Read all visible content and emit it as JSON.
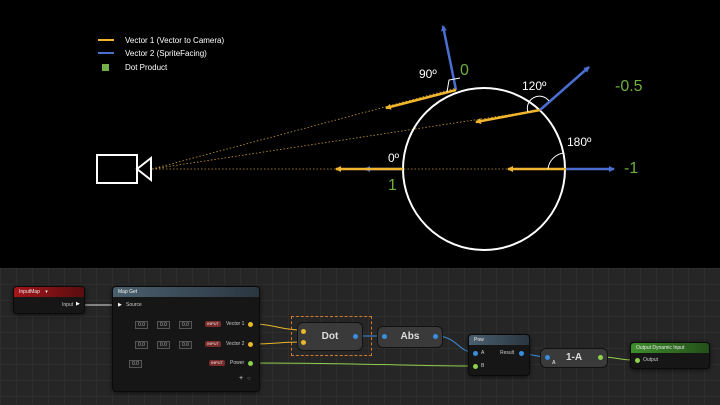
{
  "legend": {
    "vector1": "Vector 1 (Vector to Camera)",
    "vector2": "Vector 2 (SpriteFacing)",
    "dot": "Dot Product"
  },
  "angles": {
    "a90": "90º",
    "a120": "120º",
    "a180": "180º",
    "a0": "0º"
  },
  "values": {
    "v0": "0",
    "v_half": "-0.5",
    "v_neg1": "-1",
    "v1": "1"
  },
  "colors": {
    "vector1": "#f2b62e",
    "vector2": "#4a6fd0",
    "dot": "#74b04a",
    "value_text": "#6fae3e"
  },
  "nodes": {
    "input_map": {
      "title": "InputMap",
      "pin": "Input"
    },
    "map_get": {
      "title": "Map Get",
      "source": "Source",
      "vec1_tag": "INPUT",
      "vec1": "Vector 1",
      "vec2_tag": "INPUT",
      "vec2": "Vector 2",
      "power_tag": "INPUT",
      "power": "Power",
      "vec1_values": [
        "0.0",
        "0.0",
        "0.0"
      ],
      "vec2_values": [
        "0.0",
        "0.0",
        "0.0"
      ],
      "power_value": "0.0"
    },
    "dot": {
      "title": "Dot"
    },
    "abs": {
      "title": "Abs"
    },
    "pow": {
      "title": "Pow",
      "a": "A",
      "b": "B",
      "result": "Result"
    },
    "one_minus": {
      "title": "1-A",
      "a": "A"
    },
    "output": {
      "title": "Output Dynamic Input",
      "pin": "Output"
    }
  }
}
